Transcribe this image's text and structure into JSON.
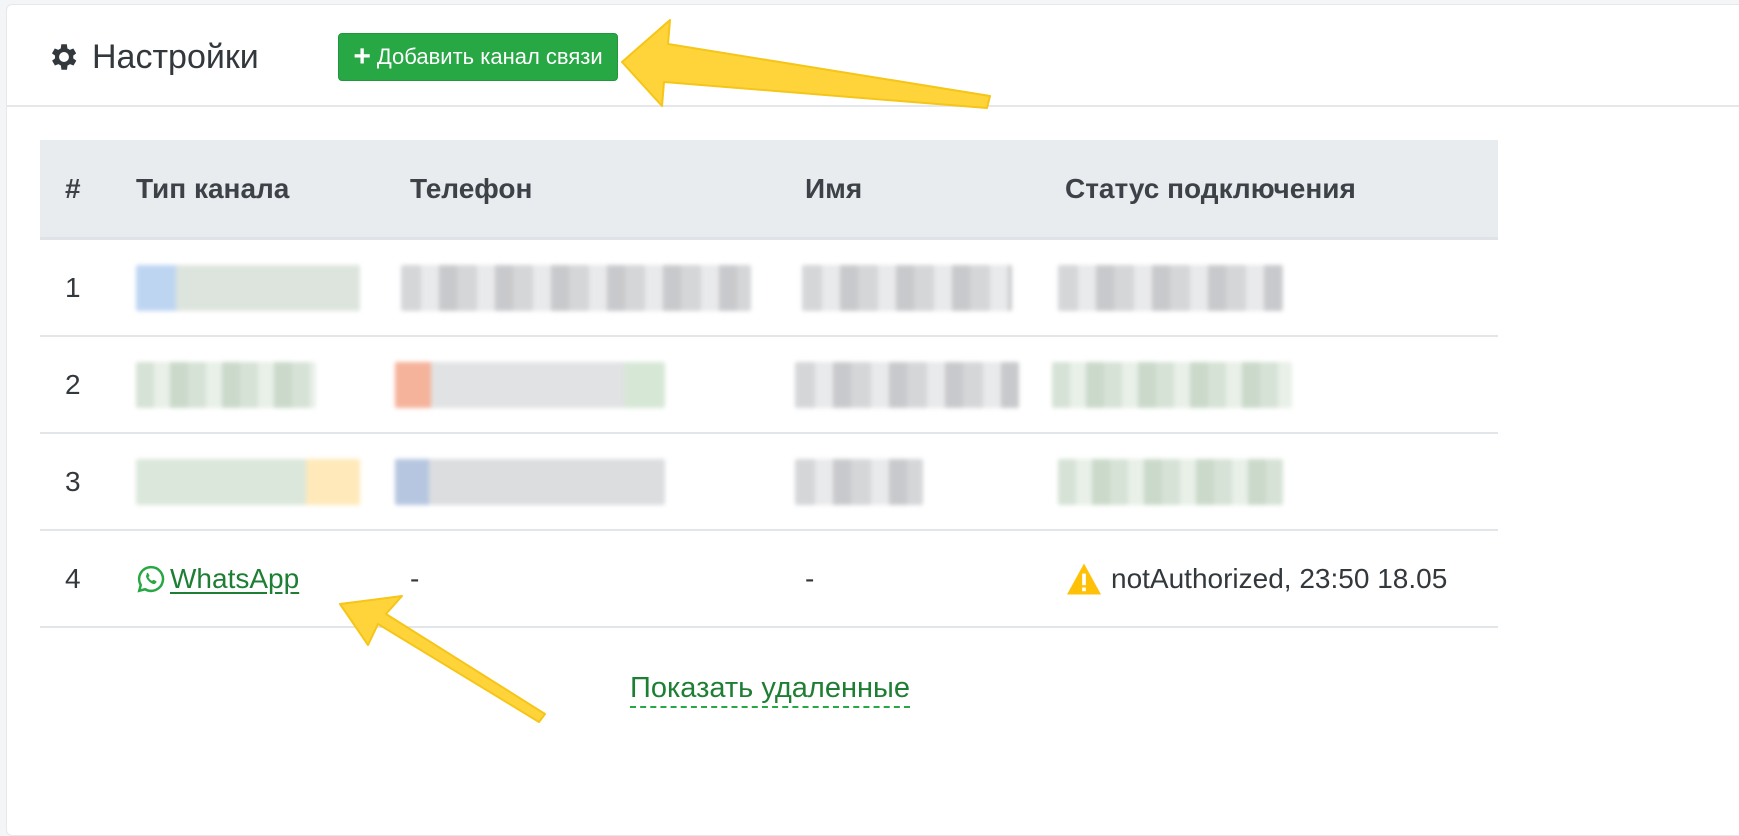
{
  "header": {
    "title": "Настройки",
    "title_icon": "gear-icon",
    "add_button_label": "Добавить канал связи",
    "add_button_icon": "plus-icon",
    "accent_color": "#28a745"
  },
  "table": {
    "columns": [
      "#",
      "Тип канала",
      "Телефон",
      "Имя",
      "Статус подключения"
    ],
    "rows": [
      {
        "num": "1",
        "redacted": true
      },
      {
        "num": "2",
        "redacted": true
      },
      {
        "num": "3",
        "redacted": true
      },
      {
        "num": "4",
        "type": "WhatsApp",
        "type_icon": "whatsapp-icon",
        "phone": "-",
        "name": "-",
        "status": "notAuthorized, 23:50 18.05",
        "status_icon": "warning-icon",
        "status_color": "#ffc107"
      }
    ]
  },
  "footer": {
    "show_deleted_label": "Показать удаленные"
  }
}
